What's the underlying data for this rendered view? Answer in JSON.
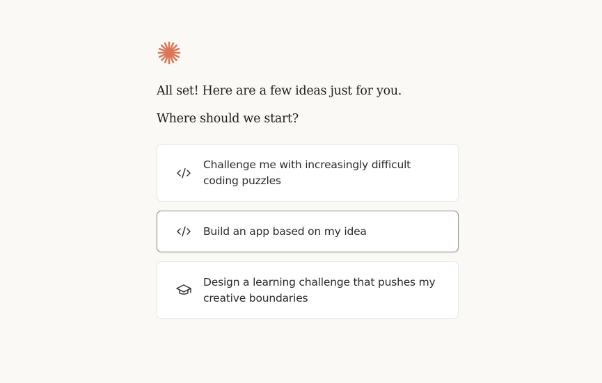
{
  "header": {
    "headline": "All set! Here are a few ideas just for you.",
    "subhead": "Where should we start?"
  },
  "colors": {
    "logo": "#d97757",
    "background": "#faf9f6"
  },
  "options": [
    {
      "icon": "code-icon",
      "label": "Challenge me with increasingly difficult coding puzzles",
      "selected": false
    },
    {
      "icon": "code-icon",
      "label": "Build an app based on my idea",
      "selected": true
    },
    {
      "icon": "graduation-cap-icon",
      "label": "Design a learning challenge that pushes my creative boundaries",
      "selected": false
    }
  ]
}
